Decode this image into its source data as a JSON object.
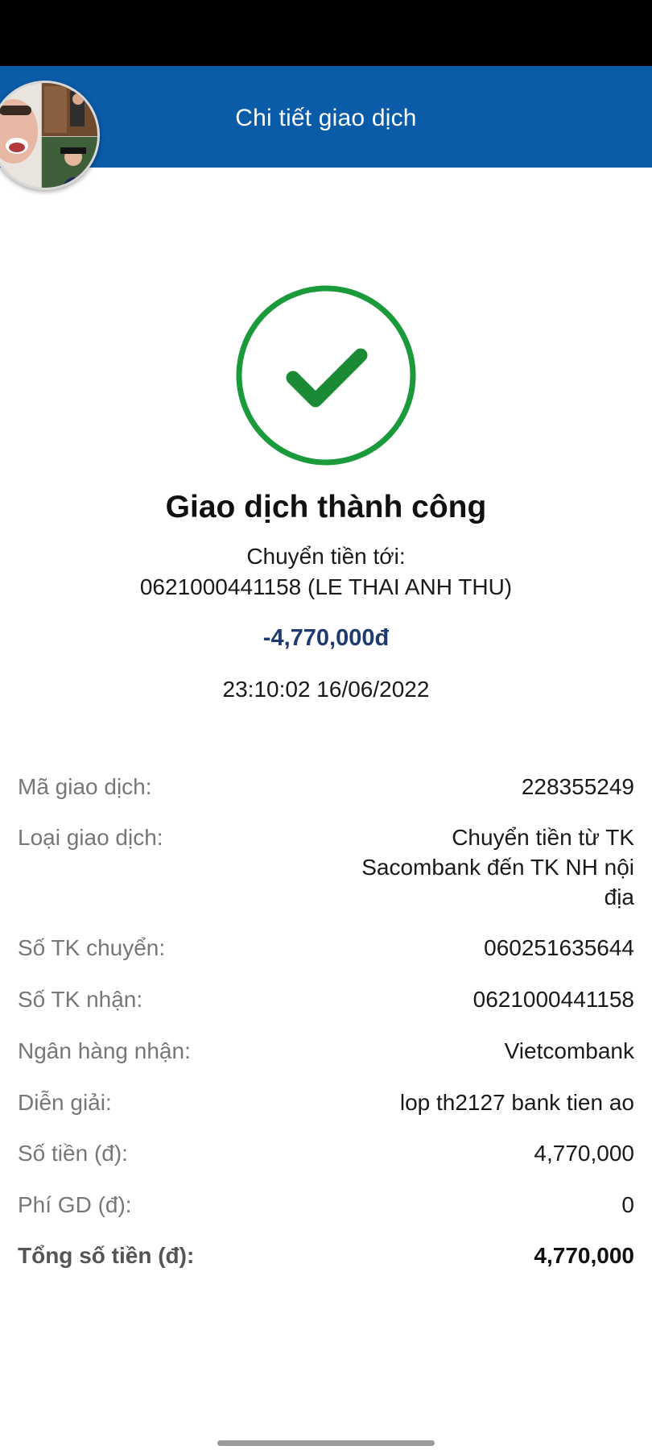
{
  "header": {
    "title": "Chi tiết giao dịch"
  },
  "status": {
    "title": "Giao dịch thành công",
    "transfer_label": "Chuyển tiền tới:",
    "transfer_target": "0621000441158 (LE THAI ANH THU)",
    "amount": "-4,770,000đ",
    "datetime": "23:10:02 16/06/2022"
  },
  "details": {
    "transaction_id": {
      "label": "Mã giao dịch:",
      "value": "228355249"
    },
    "transaction_type": {
      "label": "Loại giao dịch:",
      "value": "Chuyển tiền từ TK Sacombank đến TK NH nội địa"
    },
    "from_account": {
      "label": "Số TK chuyển:",
      "value": "060251635644"
    },
    "to_account": {
      "label": "Số TK nhận:",
      "value": "0621000441158"
    },
    "receiving_bank": {
      "label": "Ngân hàng nhận:",
      "value": "Vietcombank"
    },
    "description": {
      "label": "Diễn giải:",
      "value": "lop th2127 bank tien ao"
    },
    "amount": {
      "label": "Số tiền (đ):",
      "value": "4,770,000"
    },
    "fee": {
      "label": "Phí GD (đ):",
      "value": "0"
    },
    "total": {
      "label": "Tổng số tiền (đ):",
      "value": "4,770,000"
    }
  },
  "icons": {
    "success": "check-circle-icon",
    "avatar": "profile-avatar"
  },
  "colors": {
    "header": "#0a5ba8",
    "success": "#1a9a3a",
    "amount": "#1d3b6e"
  }
}
